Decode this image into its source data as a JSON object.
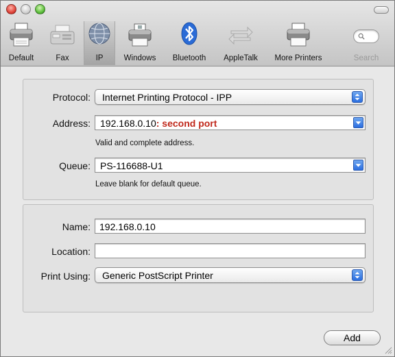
{
  "toolbar": {
    "items": [
      {
        "label": "Default",
        "icon": "printer-icon"
      },
      {
        "label": "Fax",
        "icon": "fax-icon"
      },
      {
        "label": "IP",
        "icon": "globe-icon",
        "selected": true
      },
      {
        "label": "Windows",
        "icon": "windows-printer-icon"
      },
      {
        "label": "Bluetooth",
        "icon": "bluetooth-icon"
      },
      {
        "label": "AppleTalk",
        "icon": "appletalk-icon"
      },
      {
        "label": "More Printers",
        "icon": "more-printers-icon"
      },
      {
        "label": "Search",
        "icon": "search-icon"
      }
    ]
  },
  "form": {
    "protocol": {
      "label": "Protocol:",
      "value": "Internet Printing Protocol - IPP"
    },
    "address": {
      "label": "Address:",
      "value": "192.168.0.10",
      "annotation": ": second port",
      "hint": "Valid and complete address."
    },
    "queue": {
      "label": "Queue:",
      "value": "PS-116688-U1",
      "hint": "Leave blank for default queue."
    },
    "name": {
      "label": "Name:",
      "value": "192.168.0.10"
    },
    "location": {
      "label": "Location:",
      "value": ""
    },
    "print_using": {
      "label": "Print Using:",
      "value": "Generic PostScript Printer"
    }
  },
  "buttons": {
    "add": "Add"
  },
  "colors": {
    "annotation": "#c0281b",
    "accent": "#2b6ee0"
  }
}
